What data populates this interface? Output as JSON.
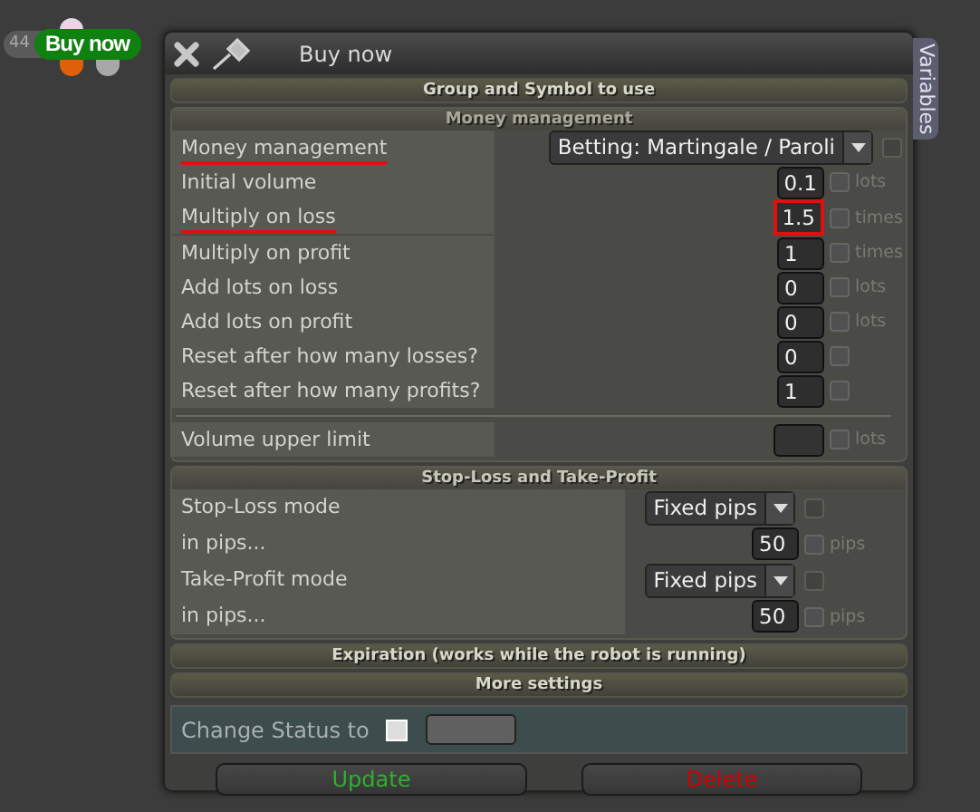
{
  "chart_node": {
    "count": "44",
    "label": "Buy now"
  },
  "window": {
    "title": "Buy now",
    "side_tab": "Variables"
  },
  "group_header": "Group and Symbol to use",
  "money_management": {
    "title": "Money management",
    "rows": [
      {
        "kind": "dropdown",
        "label": "Money management",
        "value": "Betting: Martingale / Paroli",
        "checked": false,
        "underlined": true
      },
      {
        "kind": "number",
        "label": "Initial volume",
        "value": "0.1",
        "unit": "lots",
        "checked": false,
        "underlined": false
      },
      {
        "kind": "number",
        "label": "Multiply on loss",
        "value": "1.5",
        "unit": "times",
        "checked": false,
        "underlined": true,
        "highlighted": true
      },
      {
        "kind": "number",
        "label": "Multiply on profit",
        "value": "1",
        "unit": "times",
        "checked": false,
        "underlined": false
      },
      {
        "kind": "number",
        "label": "Add lots on loss",
        "value": "0",
        "unit": "lots",
        "checked": false,
        "underlined": false
      },
      {
        "kind": "number",
        "label": "Add lots on profit",
        "value": "0",
        "unit": "lots",
        "checked": false,
        "underlined": false
      },
      {
        "kind": "number",
        "label": "Reset after how many losses?",
        "value": "0",
        "checked": false,
        "underlined": false
      },
      {
        "kind": "number",
        "label": "Reset after how many profits?",
        "value": "1",
        "checked": false,
        "underlined": false
      }
    ],
    "limit": {
      "label": "Volume upper limit",
      "unit": "lots",
      "checked": false
    }
  },
  "stop_loss": {
    "title": "Stop-Loss and Take-Profit",
    "rows": [
      {
        "kind": "dropdown",
        "label": "Stop-Loss mode",
        "value": "Fixed pips",
        "checked": false
      },
      {
        "kind": "number",
        "label": "in pips...",
        "value": "50",
        "unit": "pips",
        "checked": false
      },
      {
        "kind": "dropdown",
        "label": "Take-Profit mode",
        "value": "Fixed pips",
        "checked": false
      },
      {
        "kind": "number",
        "label": "in pips...",
        "value": "50",
        "unit": "pips",
        "checked": false
      }
    ]
  },
  "collapsed_sections": [
    "Expiration (works while the robot is running)",
    "More settings"
  ],
  "status": {
    "label": "Change Status to",
    "checked": false
  },
  "buttons": [
    {
      "label": "Update",
      "kind": "update"
    },
    {
      "label": "Delete",
      "kind": "delete"
    }
  ]
}
